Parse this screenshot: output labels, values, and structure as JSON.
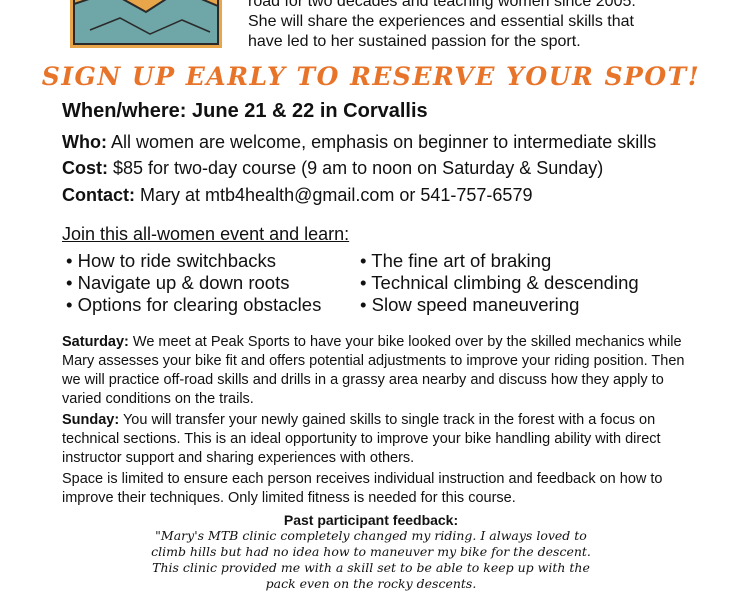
{
  "intro": {
    "line1": "road for two decades and teaching women since 2005.",
    "line2": "She will share the experiences and essential skills that",
    "line3": "have led to her sustained passion for the sport."
  },
  "signup_banner": "SIGN UP EARLY TO RESERVE YOUR SPOT!",
  "when_where": "When/where: June 21 & 22 in Corvallis",
  "who": {
    "label": "Who:",
    "text": " All women are welcome, emphasis on beginner to intermediate skills"
  },
  "cost": {
    "label": "Cost:",
    "text": " $85 for two-day course (9 am to noon on Saturday & Sunday)"
  },
  "contact": {
    "label": "Contact:",
    "text": " Mary at mtb4health@gmail.com or 541-757-6579"
  },
  "join_heading": "Join this all-women event and learn:",
  "bullets": [
    "• How to ride switchbacks",
    "• The fine art of braking",
    "• Navigate up & down roots",
    "• Technical climbing & descending",
    "• Options for clearing obstacles",
    "• Slow speed maneuvering"
  ],
  "saturday": {
    "label": "Saturday:",
    "text": " We meet at Peak Sports to have your bike looked over by the skilled mechanics while Mary assesses your bike fit and offers potential adjustments to improve your riding position. Then we will practice off-road skills and drills in a grassy area nearby and discuss how they apply to varied conditions on the trails."
  },
  "sunday": {
    "label": "Sunday:",
    "text": " You will transfer your newly gained skills to single track in the forest with a focus on technical sections. This is an ideal opportunity to improve your bike handling ability with direct instructor support and sharing experiences with others."
  },
  "space": "Space is limited to ensure each person receives individual instruction and feedback on how to improve their techniques. Only limited fitness is needed for this course.",
  "feedback_title": "Past participant feedback:",
  "quote": "\"Mary's MTB clinic completely changed my riding. I always loved to climb hills but had no idea how to maneuver my bike for the descent. This clinic provided me with a skill set to be able to keep up with the pack even on the rocky descents.",
  "colors": {
    "banner": "#e8742a",
    "logo_teal": "#6fa6a8",
    "logo_orange": "#e8a54a"
  }
}
